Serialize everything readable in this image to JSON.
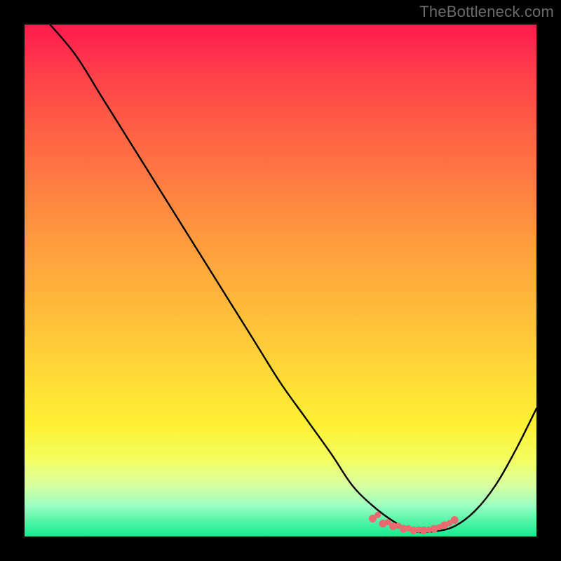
{
  "watermark": "TheBottleneck.com",
  "colors": {
    "frame": "#000000",
    "watermark_text": "#6a6a6a",
    "curve": "#000000",
    "marker": "#e96a6f",
    "gradient_stops": [
      "#ff1a4d",
      "#ff3a4a",
      "#ff5946",
      "#ff7a42",
      "#ff9a3e",
      "#ffba3a",
      "#ffd937",
      "#fff034",
      "#f3ff60",
      "#d8ffa0",
      "#9cffc0",
      "#53f5a8",
      "#17e98f"
    ]
  },
  "chart_data": {
    "type": "line",
    "title": "",
    "xlabel": "",
    "ylabel": "",
    "xlim": [
      0,
      100
    ],
    "ylim": [
      0,
      100
    ],
    "grid": false,
    "legend": false,
    "series": [
      {
        "name": "bottleneck-curve",
        "x": [
          5,
          10,
          15,
          20,
          25,
          30,
          35,
          40,
          45,
          50,
          55,
          60,
          64,
          68,
          72,
          76,
          80,
          84,
          88,
          92,
          96,
          100
        ],
        "y": [
          100,
          94,
          86,
          78,
          70,
          62,
          54,
          46,
          38,
          30,
          23,
          16,
          10,
          6,
          3,
          1,
          1,
          2,
          5,
          10,
          17,
          25
        ]
      }
    ],
    "markers": {
      "name": "min-region",
      "x": [
        68,
        70,
        72,
        74,
        76,
        78,
        80,
        82,
        84
      ],
      "y": [
        3.5,
        2.5,
        2,
        1.5,
        1.2,
        1.2,
        1.5,
        2.2,
        3.2
      ]
    }
  }
}
